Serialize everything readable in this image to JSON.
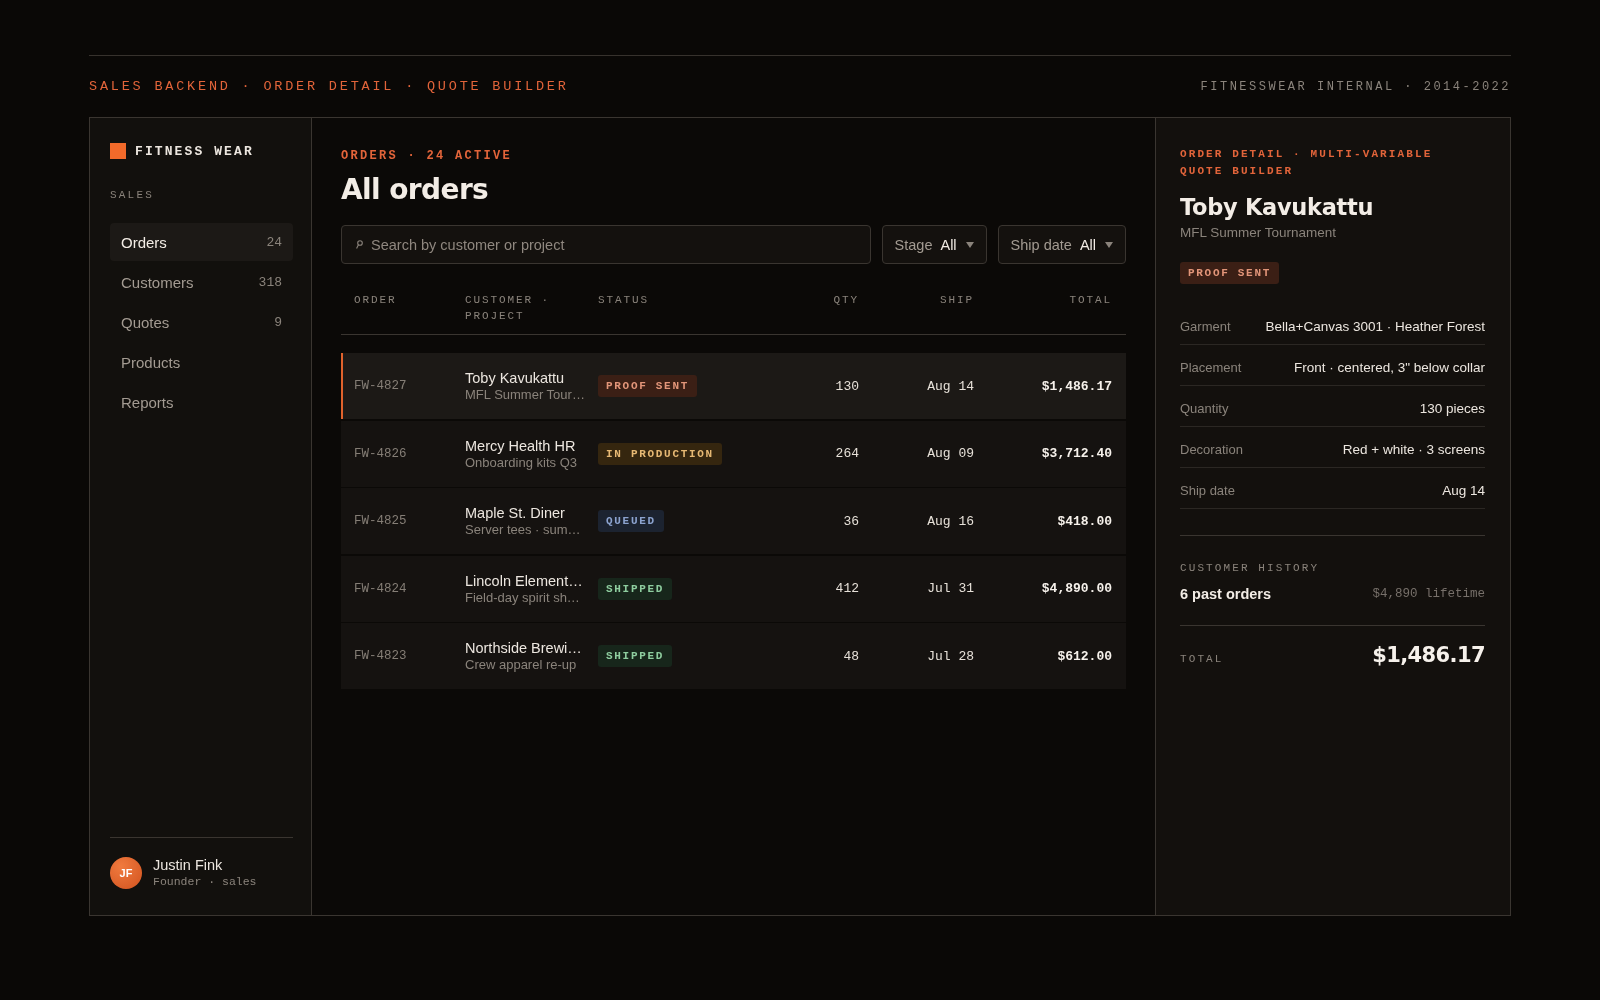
{
  "header": {
    "title": "SALES BACKEND · ORDER DETAIL · QUOTE BUILDER",
    "meta": "FITNESSWEAR INTERNAL · 2014-2022"
  },
  "sidebar": {
    "brand": "FITNESS WEAR",
    "section": "SALES",
    "items": [
      {
        "label": "Orders",
        "count": "24",
        "selected": true
      },
      {
        "label": "Customers",
        "count": "318",
        "selected": false
      },
      {
        "label": "Quotes",
        "count": "9",
        "selected": false
      },
      {
        "label": "Products",
        "selected": false
      },
      {
        "label": "Reports",
        "selected": false
      }
    ],
    "user": {
      "initials": "JF",
      "name": "Justin Fink",
      "role": "Founder · sales"
    }
  },
  "orders": {
    "eyebrow": "ORDERS · 24 ACTIVE",
    "title": "All orders",
    "search": {
      "placeholder": "Search by customer or project"
    },
    "filters": [
      {
        "label": "Stage",
        "value": "All"
      },
      {
        "label": "Ship date",
        "value": "All"
      }
    ],
    "table": {
      "columns": [
        "ORDER",
        "CUSTOMER · PROJECT",
        "STATUS",
        "QTY",
        "SHIP",
        "TOTAL"
      ],
      "rows": [
        {
          "order": "FW-4827",
          "customer": "Toby Kavukattu",
          "project": "MFL Summer Tour…",
          "status": "PROOF SENT",
          "color": "#3b1f15",
          "qty": "130",
          "ship": "Aug 14",
          "total": "$1,486.17",
          "selected": true
        },
        {
          "order": "FW-4826",
          "customer": "Mercy Health HR",
          "project": "Onboarding kits Q3",
          "status": "IN PRODUCTION",
          "color": "#35260f",
          "qty": "264",
          "ship": "Aug 09",
          "total": "$3,712.40",
          "selected": false
        },
        {
          "order": "FW-4825",
          "customer": "Maple St. Diner",
          "project": "Server tees · sum…",
          "status": "QUEUED",
          "color": "#1c2330",
          "qty": "36",
          "ship": "Aug 16",
          "total": "$418.00",
          "selected": false
        },
        {
          "order": "FW-4824",
          "customer": "Lincoln Element…",
          "project": "Field-day spirit sh…",
          "status": "SHIPPED",
          "color": "#17261b",
          "qty": "412",
          "ship": "Jul 31",
          "total": "$4,890.00",
          "selected": false
        },
        {
          "order": "FW-4823",
          "customer": "Northside Brewi…",
          "project": "Crew apparel re-up",
          "status": "SHIPPED",
          "color": "#17261b",
          "qty": "48",
          "ship": "Jul 28",
          "total": "$612.00",
          "selected": false
        }
      ]
    }
  },
  "detail": {
    "eyebrow": "ORDER DETAIL · MULTI-VARIABLE QUOTE BUILDER",
    "customer": "Toby Kavukattu",
    "project": "MFL Summer Tournament",
    "status": "PROOF SENT",
    "color": "#3b1f15",
    "fields": [
      {
        "label": "Garment",
        "value": "Bella+Canvas 3001 · Heather Forest"
      },
      {
        "label": "Placement",
        "value": "Front · centered, 3\" below collar"
      },
      {
        "label": "Quantity",
        "value": "130 pieces"
      },
      {
        "label": "Decoration",
        "value": "Red + white · 3 screens"
      },
      {
        "label": "Ship date",
        "value": "Aug 14"
      }
    ],
    "history": {
      "title": "CUSTOMER HISTORY",
      "orders": "6 past orders",
      "lifetime": "$4,890 lifetime"
    },
    "total": {
      "label": "TOTAL",
      "value": "$1,486.17"
    }
  }
}
